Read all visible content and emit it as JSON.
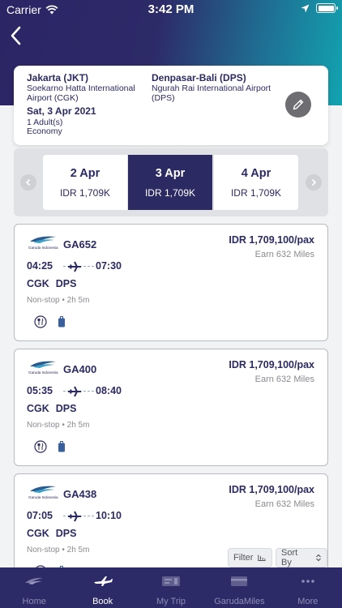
{
  "status_bar": {
    "carrier": "Carrier",
    "time": "3:42 PM"
  },
  "route": {
    "origin_city": "Jakarta (JKT)",
    "origin_airport": "Soekarno Hatta International Airport (CGK)",
    "dest_city": "Denpasar-Bali (DPS)",
    "dest_airport": "Ngurah Rai International Airport (DPS)",
    "date": "Sat, 3 Apr 2021",
    "passengers": "1 Adult(s)",
    "cabin": "Economy"
  },
  "dates": [
    {
      "date": "2 Apr",
      "price": "IDR 1,709K",
      "selected": false
    },
    {
      "date": "3 Apr",
      "price": "IDR 1,709K",
      "selected": true
    },
    {
      "date": "4 Apr",
      "price": "IDR 1,709K",
      "selected": false
    }
  ],
  "flights": [
    {
      "airline": "Garuda Indonesia",
      "flight_no": "GA652",
      "price": "IDR 1,709,100/pax",
      "miles": "Earn 632 Miles",
      "dep_time": "04:25",
      "arr_time": "07:30",
      "origin": "CGK",
      "dest": "DPS",
      "stops": "Non-stop • 2h 5m"
    },
    {
      "airline": "Garuda Indonesia",
      "flight_no": "GA400",
      "price": "IDR 1,709,100/pax",
      "miles": "Earn 632 Miles",
      "dep_time": "05:35",
      "arr_time": "08:40",
      "origin": "CGK",
      "dest": "DPS",
      "stops": "Non-stop • 2h 5m"
    },
    {
      "airline": "Garuda Indonesia",
      "flight_no": "GA438",
      "price": "IDR 1,709,100/pax",
      "miles": "Earn 632 Miles",
      "dep_time": "07:05",
      "arr_time": "10:10",
      "origin": "CGK",
      "dest": "DPS",
      "stops": "Non-stop • 2h 5m"
    }
  ],
  "controls": {
    "filter_label": "Filter",
    "sort_label": "Sort By"
  },
  "tabs": [
    {
      "label": "Home",
      "icon": "garuda-bird-icon",
      "active": false
    },
    {
      "label": "Book",
      "icon": "airplane-icon",
      "active": true
    },
    {
      "label": "My Trip",
      "icon": "trip-ticket-icon",
      "active": false
    },
    {
      "label": "GarudaMiles",
      "icon": "miles-card-icon",
      "active": false
    },
    {
      "label": "More",
      "icon": "more-dots-icon",
      "active": false
    }
  ],
  "colors": {
    "brand_navy": "#2b2a63",
    "header_teal": "#12a3b0",
    "muted_text": "#8a8a91"
  }
}
